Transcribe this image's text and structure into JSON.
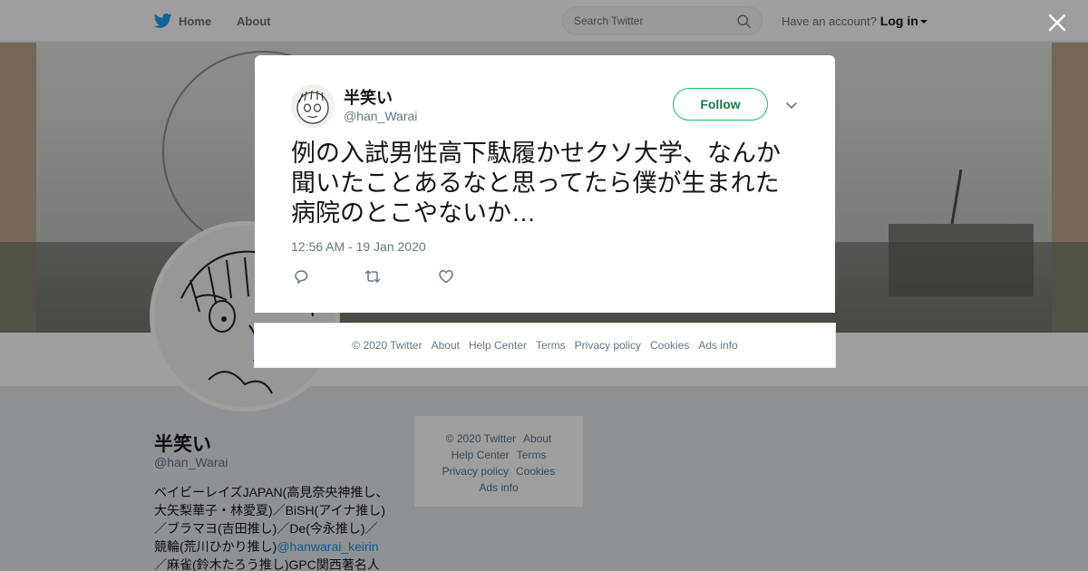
{
  "topbar": {
    "home_label": "Home",
    "about_label": "About",
    "search_placeholder": "Search Twitter",
    "account_prompt": "Have an account?",
    "login_label": "Log in"
  },
  "profile": {
    "name": "半笑い",
    "handle": "@han_Warai",
    "bio_lines": [
      "ベイビーレイズJAPAN(高見奈央神推し、",
      "大矢梨華子・林愛夏)／BiSH(アイナ推し)",
      "／ブラマヨ(吉田推し)／De(今永推し)／",
      "競輪(荒川ひかり推し)"
    ],
    "bio_mention": "@hanwarai_keirin",
    "bio_last_line": "／麻雀(鈴木たろう推し)GPC関西著名人"
  },
  "side_footer": {
    "items": [
      "© 2020 Twitter",
      "About",
      "Help Center",
      "Terms",
      "Privacy policy",
      "Cookies",
      "Ads info"
    ]
  },
  "tweet": {
    "author_name": "半笑い",
    "author_handle": "@han_Warai",
    "follow_label": "Follow",
    "text": "例の入試男性高下駄履かせクソ大学、なんか聞いたことあるなと思ってたら僕が生まれた病院のとこやないか…",
    "timestamp": "12:56 AM - 19 Jan 2020"
  },
  "modal_footer": {
    "items": [
      "© 2020 Twitter",
      "About",
      "Help Center",
      "Terms",
      "Privacy policy",
      "Cookies",
      "Ads info"
    ]
  },
  "icons": {
    "brand_blue": "#1da1f2",
    "follow_green": "#17bf63"
  }
}
